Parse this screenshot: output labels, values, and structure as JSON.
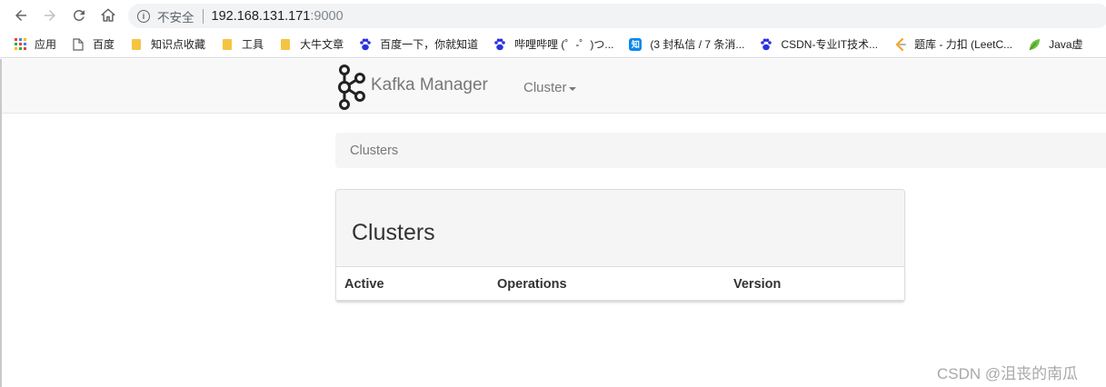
{
  "browser": {
    "security_label": "不安全",
    "info_glyph": "i",
    "url_host": "192.168.131.171",
    "url_port": ":9000",
    "bookmarks": [
      {
        "label": "应用",
        "icon": "apps-grid-icon"
      },
      {
        "label": "百度",
        "icon": "page-icon"
      },
      {
        "label": "知识点收藏",
        "icon": "folder-icon"
      },
      {
        "label": "工具",
        "icon": "folder-icon"
      },
      {
        "label": "大牛文章",
        "icon": "folder-icon"
      },
      {
        "label": "百度一下，你就知道",
        "icon": "baidu-paw-icon"
      },
      {
        "label": "哔哩哔哩 (゜-゜)つ...",
        "icon": "baidu-paw-icon"
      },
      {
        "label": "(3 封私信 / 7 条消...",
        "icon": "zhihu-icon"
      },
      {
        "label": "CSDN-专业IT技术...",
        "icon": "baidu-paw-icon"
      },
      {
        "label": "题库 - 力扣 (LeetC...",
        "icon": "leetcode-icon"
      },
      {
        "label": "Java虚",
        "icon": "leaf-icon"
      }
    ],
    "zhihu_glyph": "知"
  },
  "navbar": {
    "brand": "Kafka Manager",
    "cluster_menu": "Cluster"
  },
  "breadcrumb": {
    "current": "Clusters"
  },
  "panel": {
    "title": "Clusters",
    "columns": [
      "Active",
      "Operations",
      "Version"
    ]
  },
  "watermark": "CSDN @沮丧的南瓜",
  "colors": {
    "navbar_bg": "#f8f8f8",
    "panel_heading_bg": "#f5f5f5",
    "brand_text": "#777777",
    "folder": "#f4c542",
    "baidu_blue": "#2932e1",
    "zhihu_blue": "#0f88eb"
  }
}
